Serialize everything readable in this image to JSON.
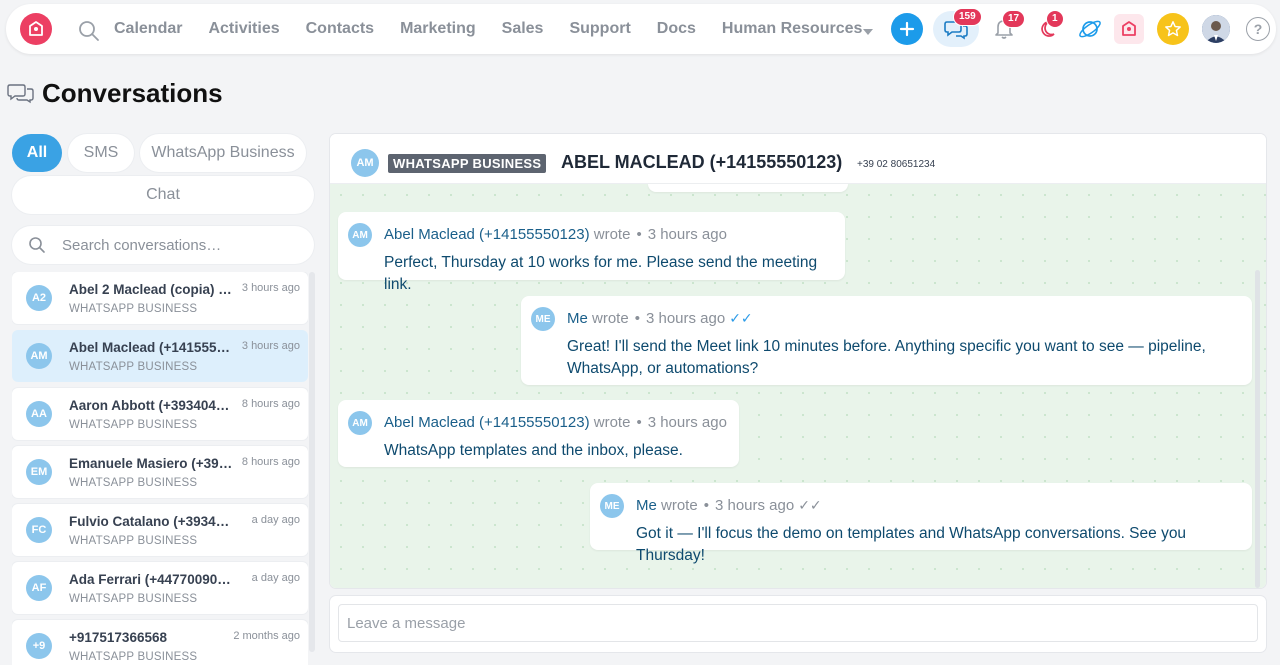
{
  "topbar": {
    "nav": [
      "Calendar",
      "Activities",
      "Contacts",
      "Marketing",
      "Sales",
      "Support",
      "Docs",
      "Human Resources"
    ],
    "badges": {
      "chat": "159",
      "notifications": "17",
      "moon": "1"
    },
    "help_label": "?"
  },
  "page": {
    "title": "Conversations"
  },
  "filters": {
    "all": "All",
    "sms": "SMS",
    "whatsapp": "WhatsApp Business",
    "chat": "Chat"
  },
  "search": {
    "placeholder": "Search conversations…"
  },
  "conversations": [
    {
      "initials": "A2",
      "name": "Abel 2 Maclead (copia) (+12…",
      "channel": "WHATSAPP BUSINESS",
      "time": "3 hours ago"
    },
    {
      "initials": "AM",
      "name": "Abel Maclead (+1415555…",
      "channel": "WHATSAPP BUSINESS",
      "time": "3 hours ago",
      "active": true
    },
    {
      "initials": "AA",
      "name": "Aaron Abbott (+3934040…",
      "channel": "WHATSAPP BUSINESS",
      "time": "8 hours ago"
    },
    {
      "initials": "EM",
      "name": "Emanuele Masiero (+393…",
      "channel": "WHATSAPP BUSINESS",
      "time": "8 hours ago"
    },
    {
      "initials": "FC",
      "name": "Fulvio Catalano (+393404…",
      "channel": "WHATSAPP BUSINESS",
      "time": "a day ago"
    },
    {
      "initials": "AF",
      "name": "Ada Ferrari (+4477009001…",
      "channel": "WHATSAPP BUSINESS",
      "time": "a day ago"
    },
    {
      "initials": "+9",
      "name": "+917517366568",
      "channel": "WHATSAPP BUSINESS",
      "time": "2 months ago"
    }
  ],
  "chat": {
    "header": {
      "initials": "AM",
      "channel_tag": "WHATSAPP BUSINESS",
      "contact_name": "ABEL MACLEAD (+14155550123)",
      "phone": "+39 02 80651234"
    },
    "messages": [
      {
        "initials": "AM",
        "author": "Abel Maclead (+14155550123)",
        "verb": "wrote",
        "time": "3 hours ago",
        "text": "Perfect, Thursday at 10 works for me. Please send the meeting link."
      },
      {
        "initials": "ME",
        "author": "Me",
        "verb": "wrote",
        "time": "3 hours ago",
        "ticks": "✓✓",
        "text_line1": "Great! I'll send the Meet link 10 minutes before. Anything specific you want to see — pipeline,",
        "text_line2": "WhatsApp, or automations?"
      },
      {
        "initials": "AM",
        "author": "Abel Maclead (+14155550123)",
        "verb": "wrote",
        "time": "3 hours ago",
        "text": "WhatsApp templates and the inbox, please."
      },
      {
        "initials": "ME",
        "author": "Me",
        "verb": "wrote",
        "time": "3 hours ago",
        "ticks": "✓✓",
        "text": "Got it — I'll focus the demo on templates and WhatsApp conversations. See you Thursday!"
      }
    ],
    "composer_placeholder": "Leave a message"
  },
  "colors": {
    "accent": "#1c9bea",
    "brand": "#ec3f63",
    "badge": "#e3385a",
    "avatar": "#8cc6ec",
    "chat_background": "#e9f4ea",
    "message_text": "#0e4a6e"
  }
}
